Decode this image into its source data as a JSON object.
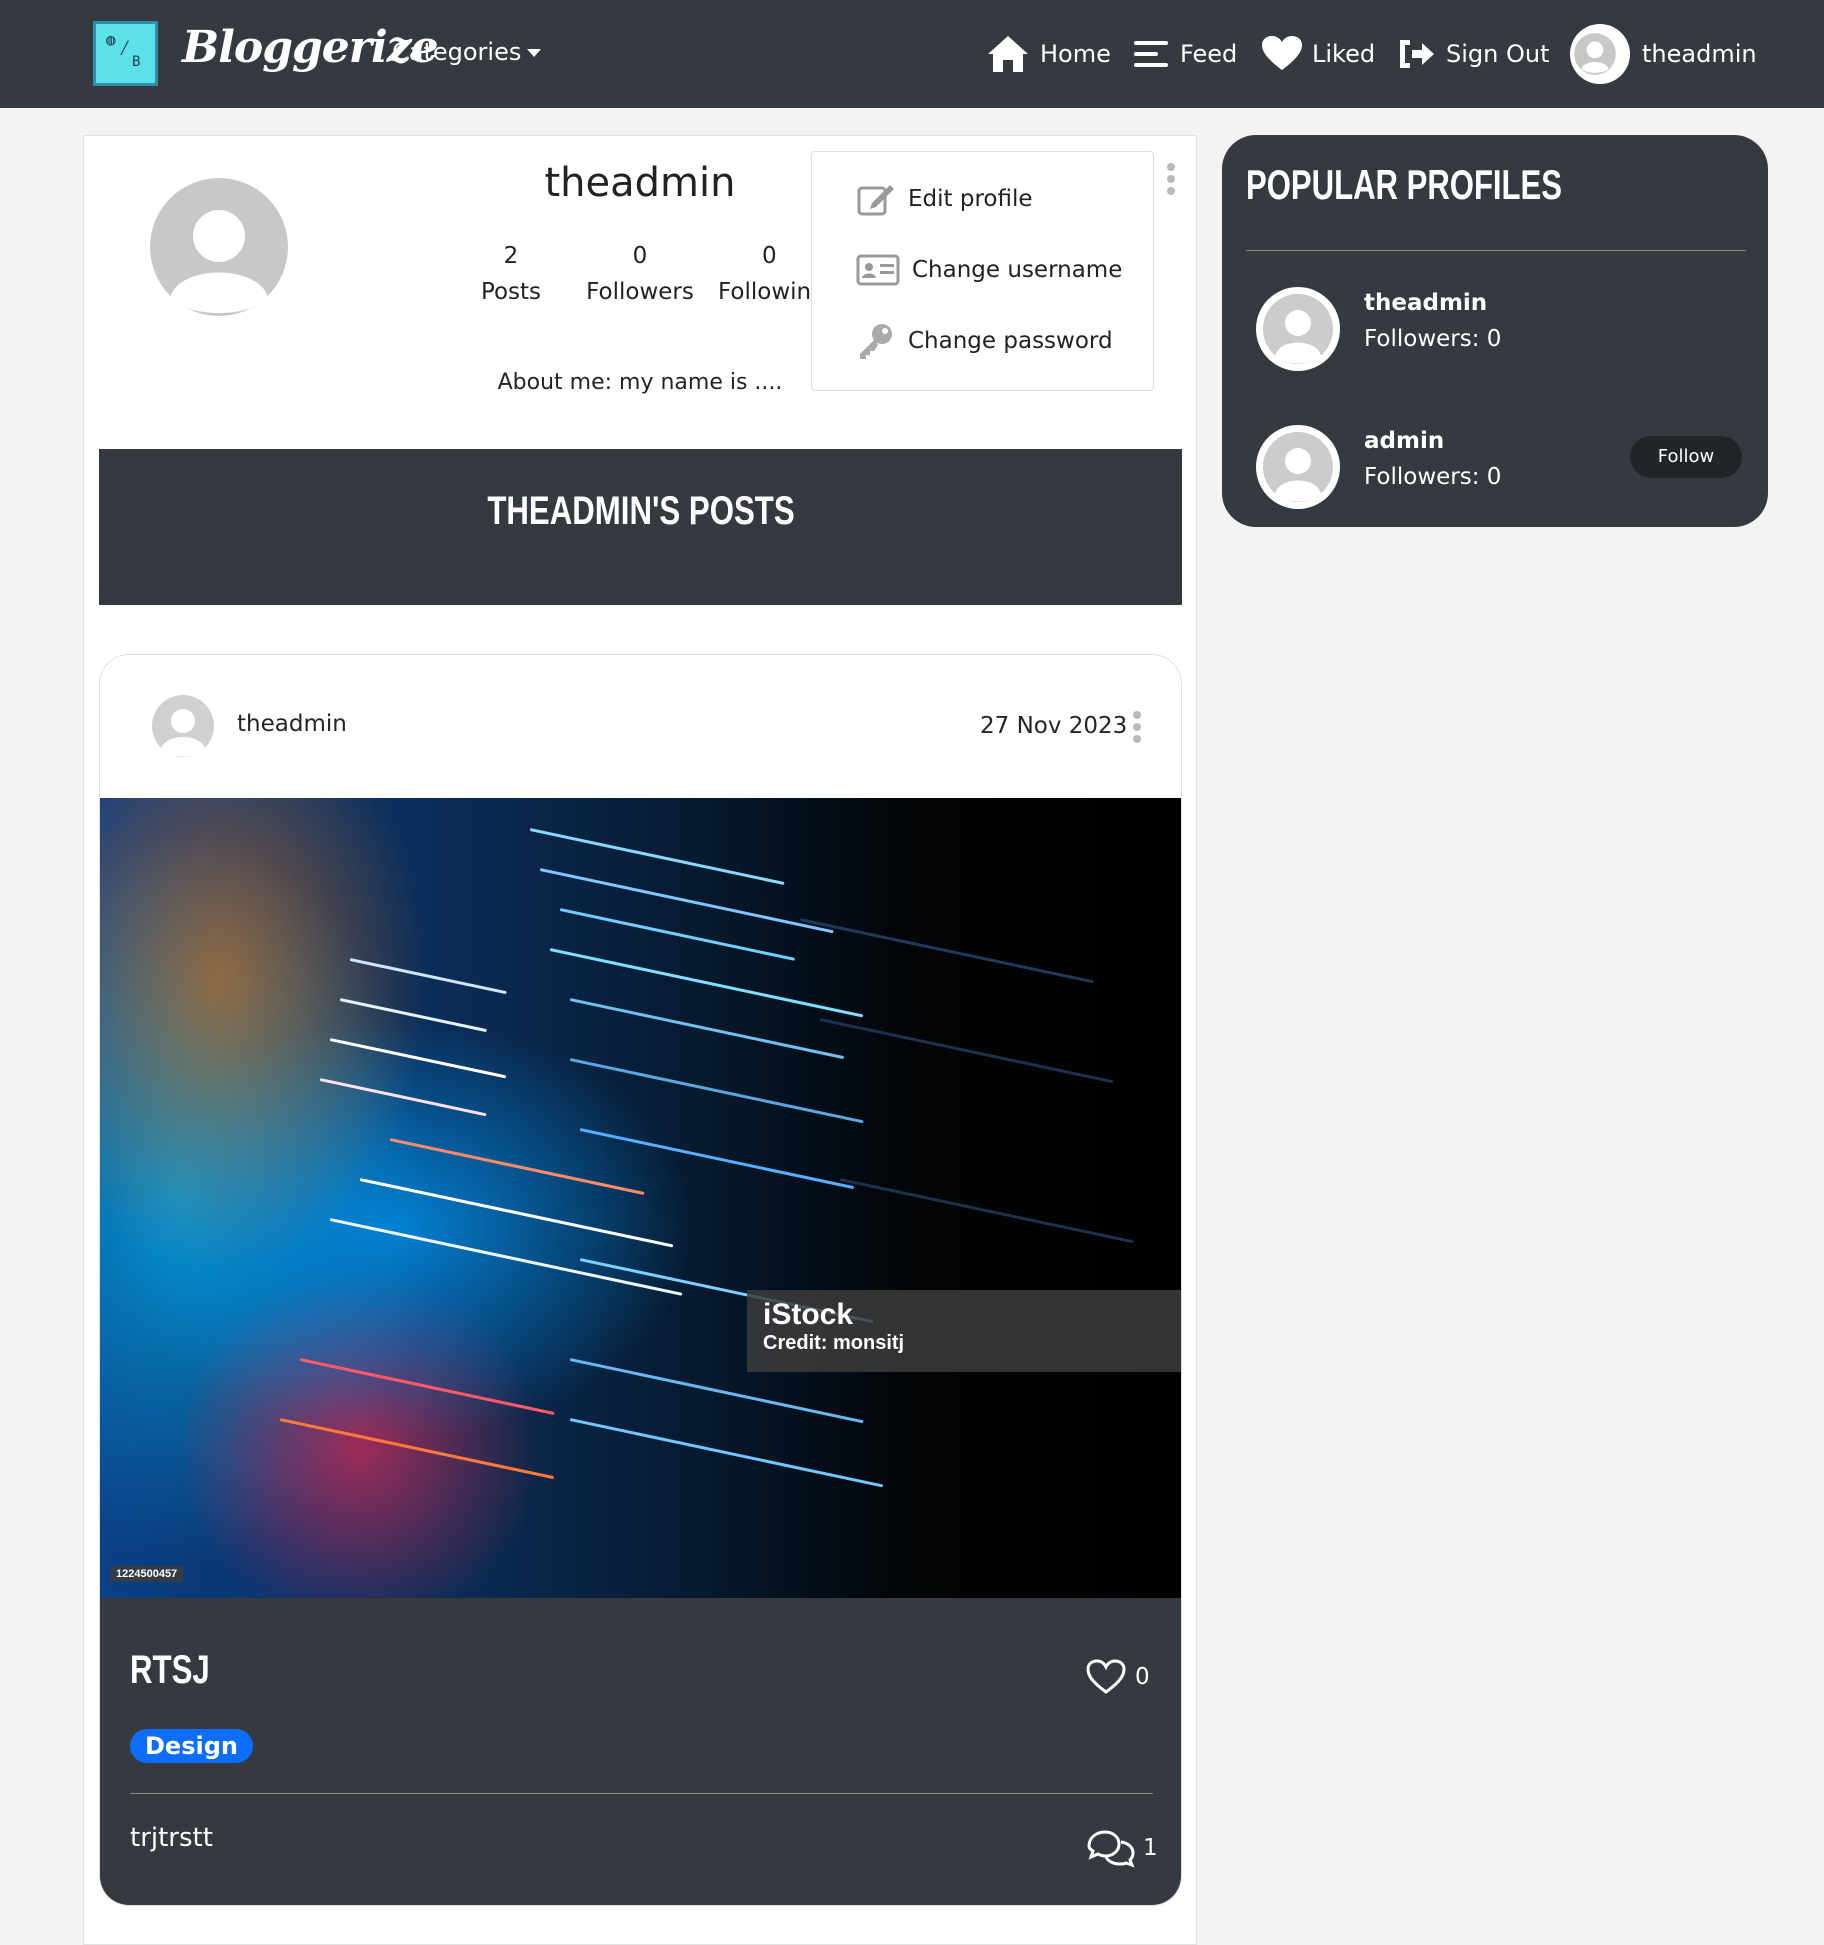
{
  "nav": {
    "brand": "Bloggerize",
    "categories_label": "Categories",
    "links": {
      "home": "Home",
      "feed": "Feed",
      "liked": "Liked",
      "signout": "Sign Out",
      "user": "theadmin"
    }
  },
  "profile": {
    "username": "theadmin",
    "stats": {
      "posts_count": "2",
      "posts_label": "Posts",
      "followers_count": "0",
      "followers_label": "Followers",
      "following_count": "0",
      "following_label": "Following"
    },
    "about": "About me: my name is ...."
  },
  "menu": {
    "edit_profile": "Edit profile",
    "change_username": "Change username",
    "change_password": "Change password"
  },
  "posts_heading": "THEADMIN'S POSTS",
  "post": {
    "author": "theadmin",
    "date": "27 Nov 2023",
    "image_brand": "iStock",
    "image_credit": "Credit: monsitj",
    "image_id": "1224500457",
    "title": "RTSJ",
    "likes": "0",
    "category": "Design",
    "category_color": "#0d6efd",
    "body": "trjtrstt",
    "comments": "1"
  },
  "sidebar": {
    "title": "POPULAR PROFILES",
    "profiles": [
      {
        "name": "theadmin",
        "followers": "Followers: 0"
      },
      {
        "name": "admin",
        "followers": "Followers: 0",
        "action": "Follow"
      }
    ]
  },
  "colors": {
    "nav_bg": "#343a40",
    "logo_bg": "#5ce1e6",
    "badge": "#0d6efd"
  }
}
